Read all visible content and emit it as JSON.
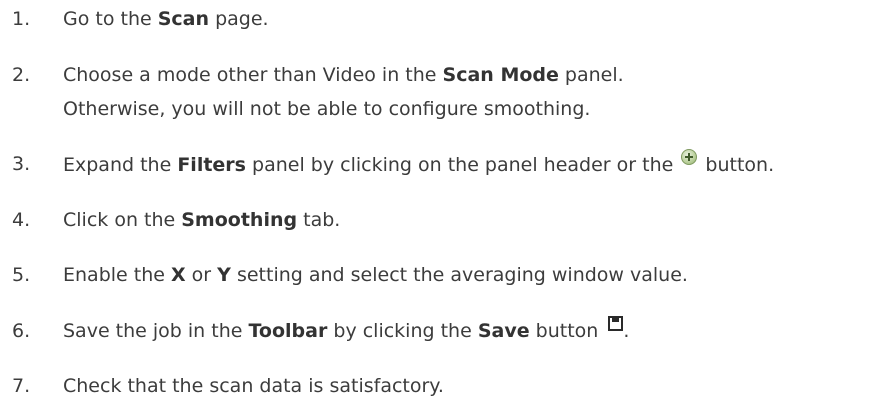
{
  "steps": [
    {
      "number": "1.",
      "parts": [
        "Go to the ",
        "Scan",
        " page."
      ]
    },
    {
      "number": "2.",
      "parts": [
        "Choose a mode other than Video in the ",
        "Scan Mode",
        " panel."
      ],
      "line2": "Otherwise, you will not be able to configure smoothing."
    },
    {
      "number": "3.",
      "parts": [
        "Expand the ",
        "Filters",
        " panel by clicking on the panel header or the ",
        " button."
      ],
      "icon": "plus-circle-icon"
    },
    {
      "number": "4.",
      "parts": [
        "Click on the ",
        "Smoothing",
        " tab."
      ]
    },
    {
      "number": "5.",
      "parts": [
        "Enable the ",
        "X",
        " or ",
        "Y",
        " setting and select the averaging window value."
      ]
    },
    {
      "number": "6.",
      "parts": [
        "Save the job in the ",
        "Toolbar",
        " by clicking the ",
        "Save",
        " button ",
        "."
      ],
      "icon": "save-icon"
    },
    {
      "number": "7.",
      "parts": [
        "Check that the scan data is satisfactory."
      ]
    }
  ]
}
